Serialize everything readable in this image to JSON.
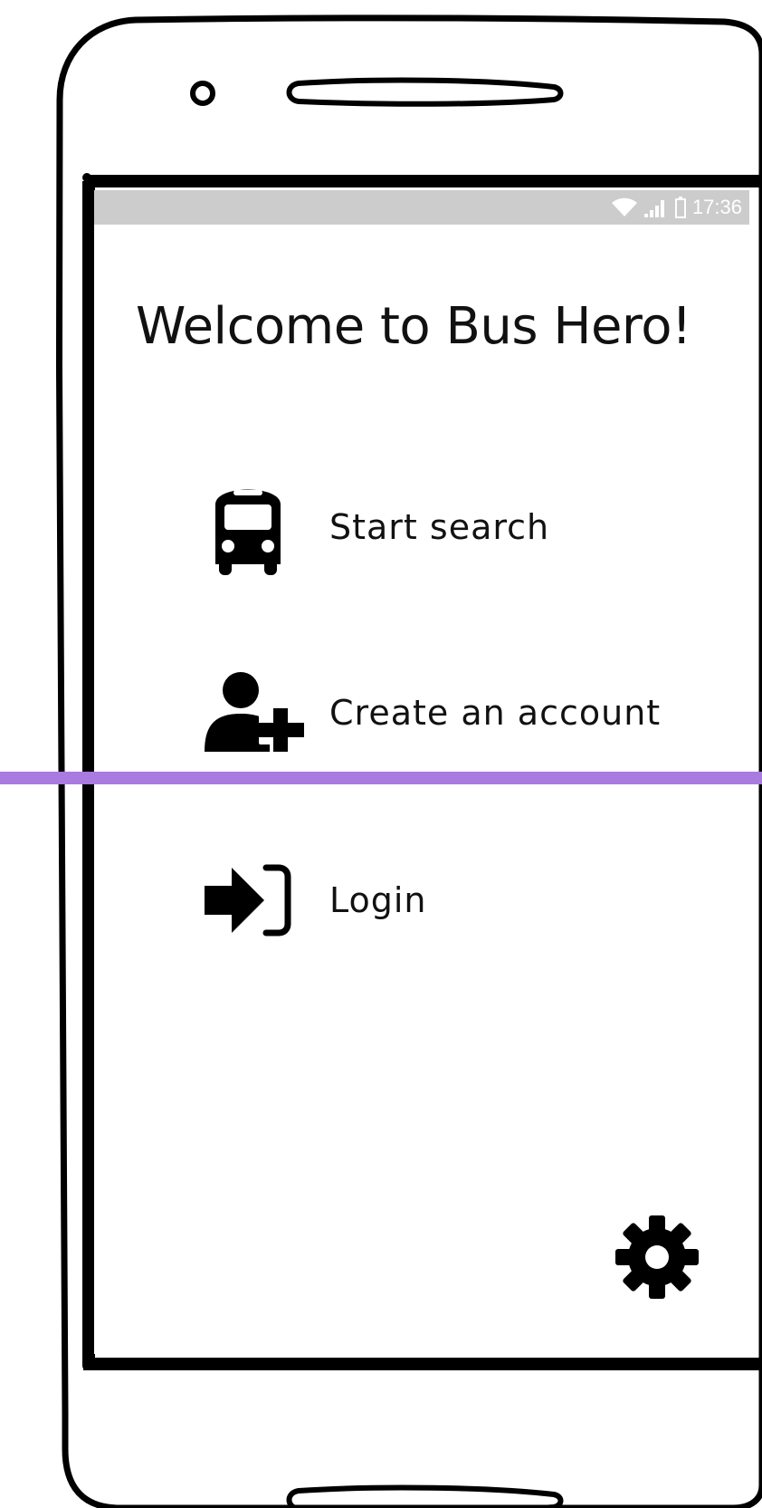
{
  "status_bar": {
    "time": "17:36",
    "icons": [
      "wifi-icon",
      "signal-icon",
      "battery-icon"
    ]
  },
  "main": {
    "title": "Welcome to Bus Hero!"
  },
  "menu": {
    "items": [
      {
        "label": "Start search",
        "icon": "bus-icon"
      },
      {
        "label": "Create an account",
        "icon": "add-user-icon"
      },
      {
        "label": "Login",
        "icon": "login-icon"
      }
    ]
  },
  "settings": {
    "icon": "gear-icon"
  },
  "colors": {
    "status_bar_bg": "#cccccc",
    "divider": "#a97ae0",
    "ink": "#111111"
  }
}
